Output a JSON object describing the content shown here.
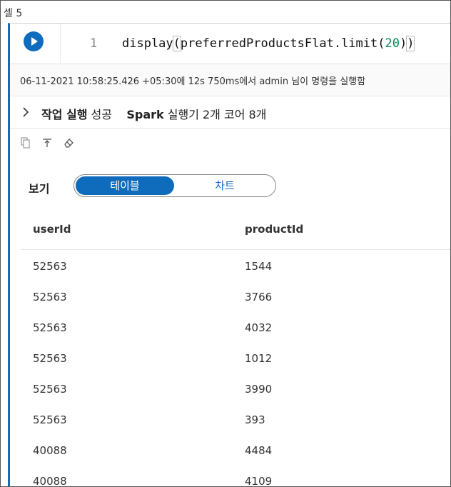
{
  "cell": {
    "label": "셀 5",
    "line_number": "1",
    "code": {
      "fn": "display",
      "open": "(",
      "arg": "preferredProductsFlat.limit(",
      "num": "20",
      "close_inner": ")",
      "close": ")"
    }
  },
  "status": {
    "text": "06-11-2021 10:58:25.426 +05:30에 12s 750ms에서 admin 님이 명령을 실행함"
  },
  "job": {
    "title": "작업 실행",
    "result": "성공",
    "engine": "Spark",
    "detail": "실행기 2개 코어 8개"
  },
  "toolbar": {
    "icons": [
      "copy-icon",
      "pin-icon",
      "eraser-icon"
    ]
  },
  "view": {
    "label": "보기",
    "options": [
      "테이블",
      "차트"
    ],
    "selected": "테이블"
  },
  "table": {
    "columns": [
      "userId",
      "productId"
    ],
    "rows": [
      [
        "52563",
        "1544"
      ],
      [
        "52563",
        "3766"
      ],
      [
        "52563",
        "4032"
      ],
      [
        "52563",
        "1012"
      ],
      [
        "52563",
        "3990"
      ],
      [
        "52563",
        "393"
      ],
      [
        "40088",
        "4484"
      ],
      [
        "40088",
        "4109"
      ]
    ]
  },
  "colors": {
    "accent": "#0f6cbd",
    "number": "#098658"
  }
}
